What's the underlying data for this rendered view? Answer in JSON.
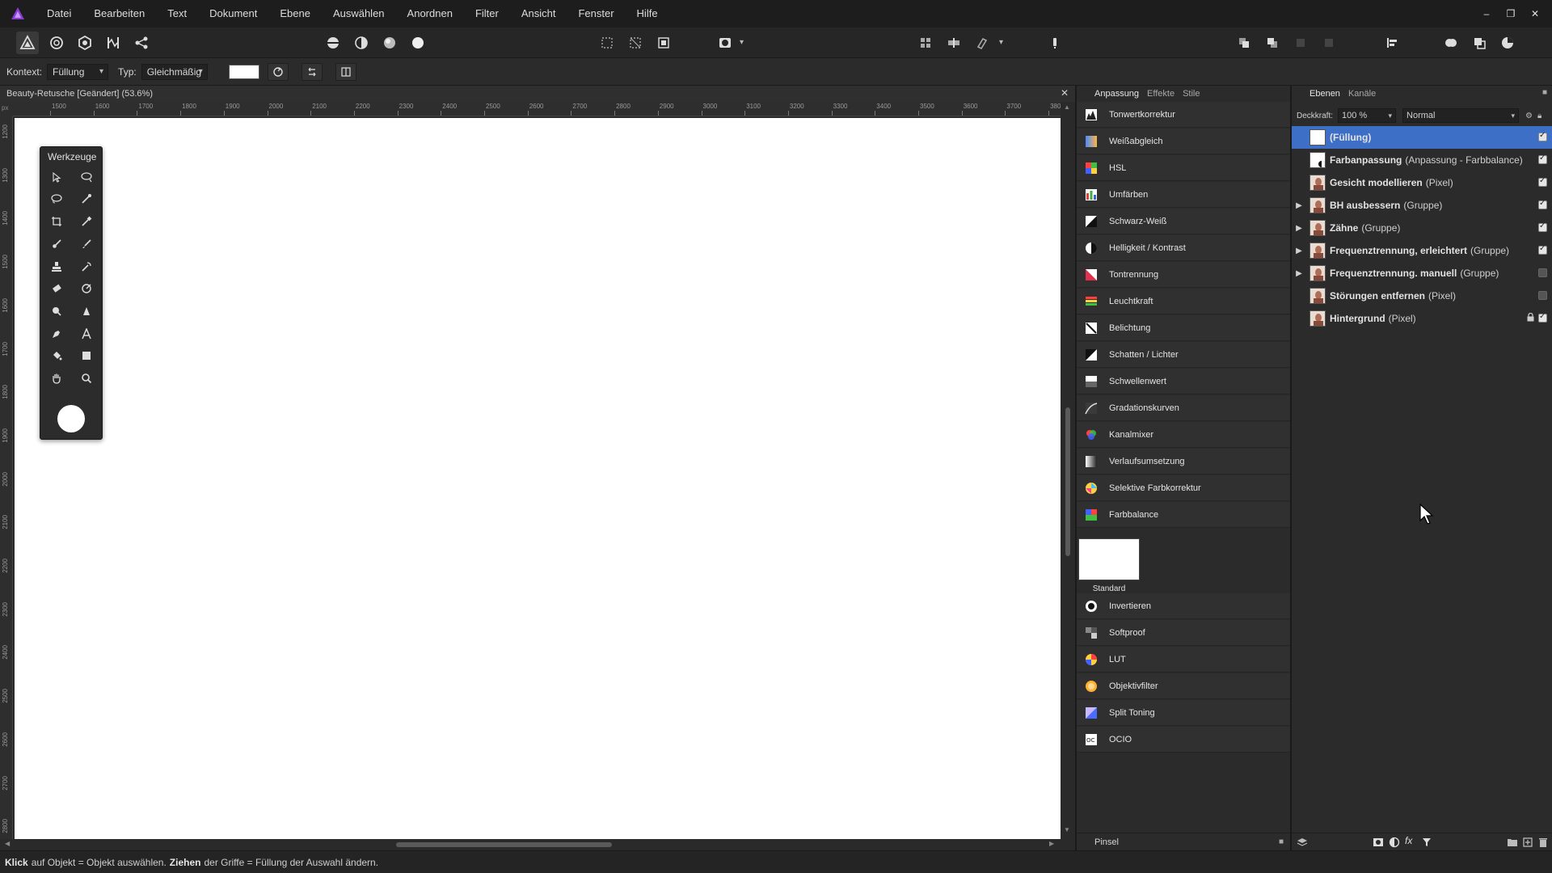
{
  "menu": {
    "items": [
      "Datei",
      "Bearbeiten",
      "Text",
      "Dokument",
      "Ebene",
      "Auswählen",
      "Anordnen",
      "Filter",
      "Ansicht",
      "Fenster",
      "Hilfe"
    ]
  },
  "window_controls": {
    "minimize": "–",
    "restore": "❐",
    "close": "✕"
  },
  "context_bar": {
    "context_label": "Kontext:",
    "context_value": "Füllung",
    "type_label": "Typ:",
    "type_value": "Gleichmäßig"
  },
  "document": {
    "tab_title": "Beauty-Retusche [Geändert] (53.6%)",
    "ruler_unit": "px",
    "ruler_top": [
      "1500",
      "1600",
      "1700",
      "1800",
      "1900",
      "2000",
      "2100",
      "2200",
      "2300",
      "2400",
      "2500",
      "2600",
      "2700",
      "2800",
      "2900",
      "3000",
      "3100",
      "3200",
      "3300",
      "3400",
      "3500",
      "3600",
      "3700",
      "3800"
    ],
    "ruler_left": [
      "1200",
      "1300",
      "1400",
      "1500",
      "1600",
      "1700",
      "1800",
      "1900",
      "2000",
      "2100",
      "2200",
      "2300",
      "2400",
      "2500",
      "2600",
      "2700",
      "2800"
    ]
  },
  "tools_panel": {
    "title": "Werkzeuge"
  },
  "adjustments_panel": {
    "tabs": [
      "Anpassung",
      "Effekte",
      "Stile"
    ],
    "items": [
      {
        "label": "Tonwertkorrektur",
        "icon": "levels-icon"
      },
      {
        "label": "Weißabgleich",
        "icon": "white-balance-icon"
      },
      {
        "label": "HSL",
        "icon": "hsl-icon"
      },
      {
        "label": "Umfärben",
        "icon": "recolor-icon"
      },
      {
        "label": "Schwarz-Weiß",
        "icon": "black-white-icon"
      },
      {
        "label": "Helligkeit / Kontrast",
        "icon": "brightness-contrast-icon"
      },
      {
        "label": "Tontrennung",
        "icon": "posterize-icon"
      },
      {
        "label": "Leuchtkraft",
        "icon": "vibrance-icon"
      },
      {
        "label": "Belichtung",
        "icon": "exposure-icon"
      },
      {
        "label": "Schatten / Lichter",
        "icon": "shadows-highlights-icon"
      },
      {
        "label": "Schwellenwert",
        "icon": "threshold-icon"
      },
      {
        "label": "Gradationskurven",
        "icon": "curves-icon"
      },
      {
        "label": "Kanalmixer",
        "icon": "channel-mixer-icon"
      },
      {
        "label": "Verlaufsumsetzung",
        "icon": "gradient-map-icon"
      },
      {
        "label": "Selektive Farbkorrektur",
        "icon": "selective-color-icon"
      },
      {
        "label": "Farbbalance",
        "icon": "color-balance-icon"
      }
    ],
    "preset_label": "Standard",
    "items_after": [
      {
        "label": "Invertieren",
        "icon": "invert-icon"
      },
      {
        "label": "Softproof",
        "icon": "softproof-icon"
      },
      {
        "label": "LUT",
        "icon": "lut-icon"
      },
      {
        "label": "Objektivfilter",
        "icon": "lens-filter-icon"
      },
      {
        "label": "Split Toning",
        "icon": "split-toning-icon"
      },
      {
        "label": "OCIO",
        "icon": "ocio-icon"
      }
    ],
    "bottom_tab": "Pinsel"
  },
  "layers_panel": {
    "tabs": [
      "Ebenen",
      "Kanäle"
    ],
    "opacity_label": "Deckkraft:",
    "opacity_value": "100 %",
    "blend_mode": "Normal",
    "layers": [
      {
        "name": "(Füllung)",
        "type": "",
        "expandable": false,
        "selected": true,
        "visible": true,
        "locked": false
      },
      {
        "name": "Farbanpassung",
        "type": "(Anpassung - Farbbalance)",
        "expandable": false,
        "selected": false,
        "visible": true,
        "locked": false
      },
      {
        "name": "Gesicht modellieren",
        "type": "(Pixel)",
        "expandable": false,
        "selected": false,
        "visible": true,
        "locked": false
      },
      {
        "name": "BH ausbessern",
        "type": "(Gruppe)",
        "expandable": true,
        "selected": false,
        "visible": true,
        "locked": false
      },
      {
        "name": "Zähne",
        "type": "(Gruppe)",
        "expandable": true,
        "selected": false,
        "visible": true,
        "locked": false
      },
      {
        "name": "Frequenztrennung, erleichtert",
        "type": "(Gruppe)",
        "expandable": true,
        "selected": false,
        "visible": true,
        "locked": false
      },
      {
        "name": "Frequenztrennung. manuell",
        "type": "(Gruppe)",
        "expandable": true,
        "selected": false,
        "visible": false,
        "locked": false
      },
      {
        "name": "Störungen entfernen",
        "type": "(Pixel)",
        "expandable": false,
        "selected": false,
        "visible": false,
        "locked": false
      },
      {
        "name": "Hintergrund",
        "type": "(Pixel)",
        "expandable": false,
        "selected": false,
        "visible": true,
        "locked": true
      }
    ]
  },
  "status_bar": {
    "part1_strong": "Klick",
    "part1_text": "auf Objekt = Objekt auswählen.",
    "part2_strong": "Ziehen",
    "part2_text": "der Griffe = Füllung der Auswahl ändern."
  },
  "colors": {
    "selection": "#3e6fc6",
    "app_accent": "#8a3bd8",
    "panel_bg": "#2b2b2b"
  }
}
